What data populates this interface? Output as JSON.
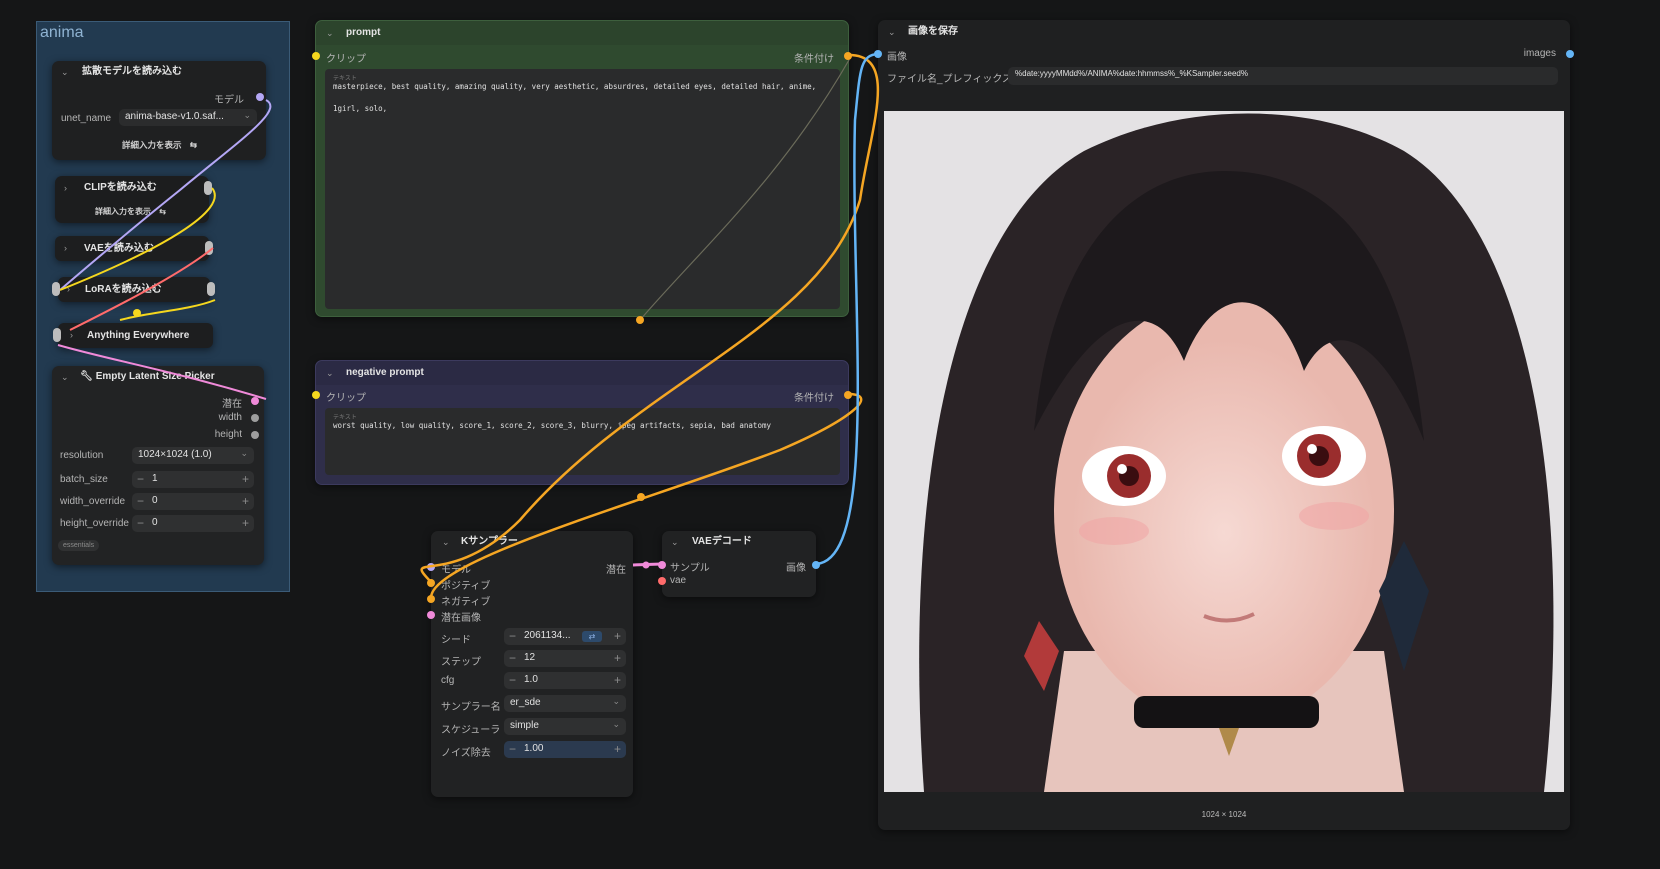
{
  "group": {
    "title": "anima"
  },
  "diffusion_node": {
    "title": "拡散モデルを読み込む",
    "output_label": "モデル",
    "field_label": "unet_name",
    "field_value": "anima-base-v1.0.saf...",
    "details_button": "詳細入力を表示"
  },
  "clip_node": {
    "title": "CLIPを読み込む",
    "details_button": "詳細入力を表示"
  },
  "vae_node": {
    "title": "VAEを読み込む"
  },
  "lora_node": {
    "title": "LoRAを読み込む"
  },
  "anything_node": {
    "title": "Anything Everywhere"
  },
  "latent_node": {
    "title": "Empty Latent Size Picker",
    "outputs": [
      "潜在",
      "width",
      "height"
    ],
    "resolution_label": "resolution",
    "resolution_value": "1024×1024 (1.0)",
    "batch_label": "batch_size",
    "batch_value": "1",
    "width_override_label": "width_override",
    "width_override_value": "0",
    "height_override_label": "height_override",
    "height_override_value": "0",
    "badge": "essentials"
  },
  "prompt_node": {
    "title": "prompt",
    "input_label": "クリップ",
    "output_label": "条件付け",
    "text_caption": "テキスト",
    "text": "masterpiece, best quality, amazing quality, very aesthetic, absurdres, detailed eyes, detailed hair, anime,\n\n1girl, solo,"
  },
  "negative_node": {
    "title": "negative prompt",
    "input_label": "クリップ",
    "output_label": "条件付け",
    "text_caption": "テキスト",
    "text": "worst quality, low quality, score_1, score_2, score_3, blurry, jpeg artifacts, sepia, bad anatomy"
  },
  "ksampler_node": {
    "title": "Kサンプラー",
    "inputs": [
      "モデル",
      "ポジティブ",
      "ネガティブ",
      "潜在画像"
    ],
    "output_label": "潜在",
    "seed_label": "シード",
    "seed_value": "2061134...",
    "steps_label": "ステップ",
    "steps_value": "12",
    "cfg_label": "cfg",
    "cfg_value": "1.0",
    "sampler_label": "サンプラー名",
    "sampler_value": "er_sde",
    "scheduler_label": "スケジューラ",
    "scheduler_value": "simple",
    "denoise_label": "ノイズ除去",
    "denoise_value": "1.00",
    "denoise_level": 1.0
  },
  "vae_decode_node": {
    "title": "VAEデコード",
    "inputs": [
      "サンプル",
      "vae"
    ],
    "output_label": "画像"
  },
  "save_node": {
    "title": "画像を保存",
    "input_label": "画像",
    "output_label": "images",
    "prefix_label": "ファイル名_プレフィックス",
    "prefix_value": "%date:yyyyMMdd%/ANIMA%date:hhmmss%_%KSampler.seed%",
    "image_size": "1024 × 1024"
  },
  "colors": {
    "canvas": "#151617",
    "node": "#242526",
    "prompt_node": "#2f4a2f",
    "negative_node": "#2f2e4a",
    "group": "#223a50",
    "conditioning": "#f5a623",
    "model": "#b4a7f5",
    "latent": "#f08ad9",
    "image": "#64b5f6",
    "clip": "#f5d71e",
    "vae": "#ff6b6b"
  }
}
